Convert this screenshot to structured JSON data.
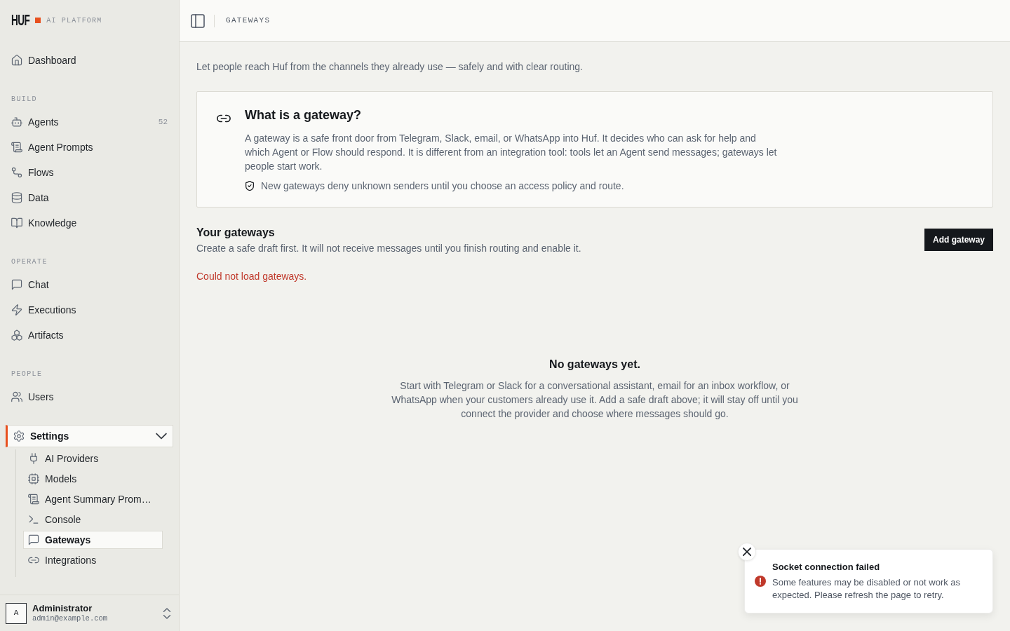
{
  "brand": {
    "wordmark": "HUF",
    "tagline": "AI PLATFORM"
  },
  "sidebar": {
    "sections": [
      {
        "items": [
          {
            "label": "Dashboard",
            "selected": false
          }
        ]
      },
      {
        "heading": "BUILD",
        "items": [
          {
            "label": "Agents",
            "count": "52",
            "selected": false
          },
          {
            "label": "Agent Prompts",
            "selected": false
          },
          {
            "label": "Flows",
            "selected": false
          },
          {
            "label": "Data",
            "selected": false
          },
          {
            "label": "Knowledge",
            "selected": false
          }
        ]
      },
      {
        "heading": "OPERATE",
        "items": [
          {
            "label": "Chat",
            "selected": false
          },
          {
            "label": "Executions",
            "selected": false
          },
          {
            "label": "Artifacts",
            "selected": false
          }
        ]
      },
      {
        "heading": "PEOPLE",
        "items": [
          {
            "label": "Users",
            "selected": false
          }
        ]
      },
      {
        "items": [
          {
            "label": "Settings",
            "selected": true,
            "expanded": true,
            "children": [
              {
                "label": "AI Providers",
                "selected": false
              },
              {
                "label": "Models",
                "selected": false
              },
              {
                "label": "Agent Summary Prom…",
                "selected": false
              },
              {
                "label": "Console",
                "selected": false
              },
              {
                "label": "Gateways",
                "selected": true
              },
              {
                "label": "Integrations",
                "selected": false
              }
            ]
          }
        ]
      }
    ],
    "user": {
      "initial": "A",
      "name": "Administrator",
      "email": "admin@example.com"
    }
  },
  "header": {
    "breadcrumb": "GATEWAYS"
  },
  "page": {
    "intro": "Let people reach Huf from the channels they already use — safely and with clear routing.",
    "info_card": {
      "title": "What is a gateway?",
      "body": "A gateway is a safe front door from Telegram, Slack, email, or WhatsApp into Huf. It decides who can ask for help and which Agent or Flow should respond. It is different from an integration tool: tools let an Agent send messages; gateways let people start work.",
      "note": "New gateways deny unknown senders until you choose an access policy and route."
    },
    "gateways": {
      "title": "Your gateways",
      "subtitle": "Create a safe draft first. It will not receive messages until you finish routing and enable it.",
      "button": "Add gateway",
      "error": "Could not load gateways.",
      "empty_state": {
        "title": "No gateways yet.",
        "body": "Start with Telegram or Slack for a conversational assistant, email for an inbox workflow, or WhatsApp when your customers already use it. Add a safe draft above; it will stay off until you connect the provider and choose where messages should go."
      }
    }
  },
  "toast": {
    "title": "Socket connection failed",
    "message": "Some features may be disabled or not work as expected. Please refresh the page to retry."
  }
}
